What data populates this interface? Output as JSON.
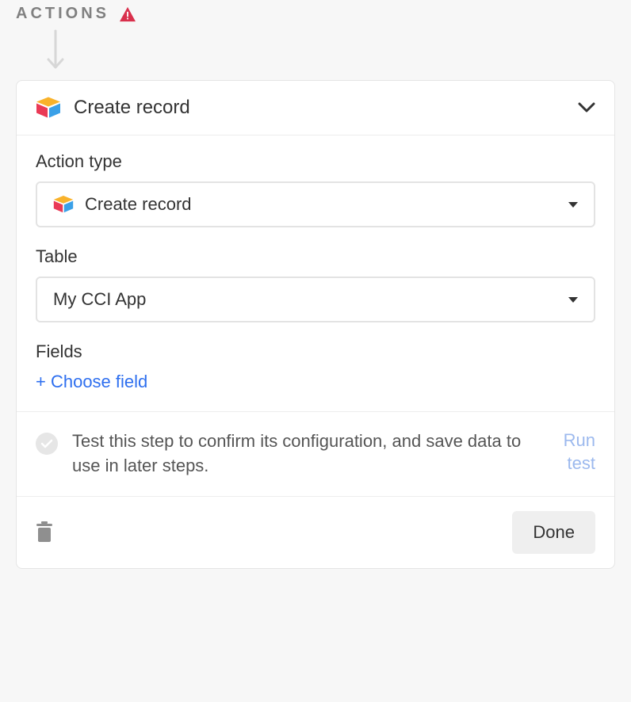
{
  "header": {
    "label": "ACTIONS"
  },
  "card": {
    "title": "Create record",
    "actionType": {
      "label": "Action type",
      "value": "Create record"
    },
    "table": {
      "label": "Table",
      "value": "My CCI App"
    },
    "fields": {
      "label": "Fields",
      "choose": "+ Choose field"
    },
    "test": {
      "text": "Test this step to confirm its configuration, and save data to use in later steps.",
      "run": "Run test"
    },
    "footer": {
      "done": "Done"
    }
  }
}
